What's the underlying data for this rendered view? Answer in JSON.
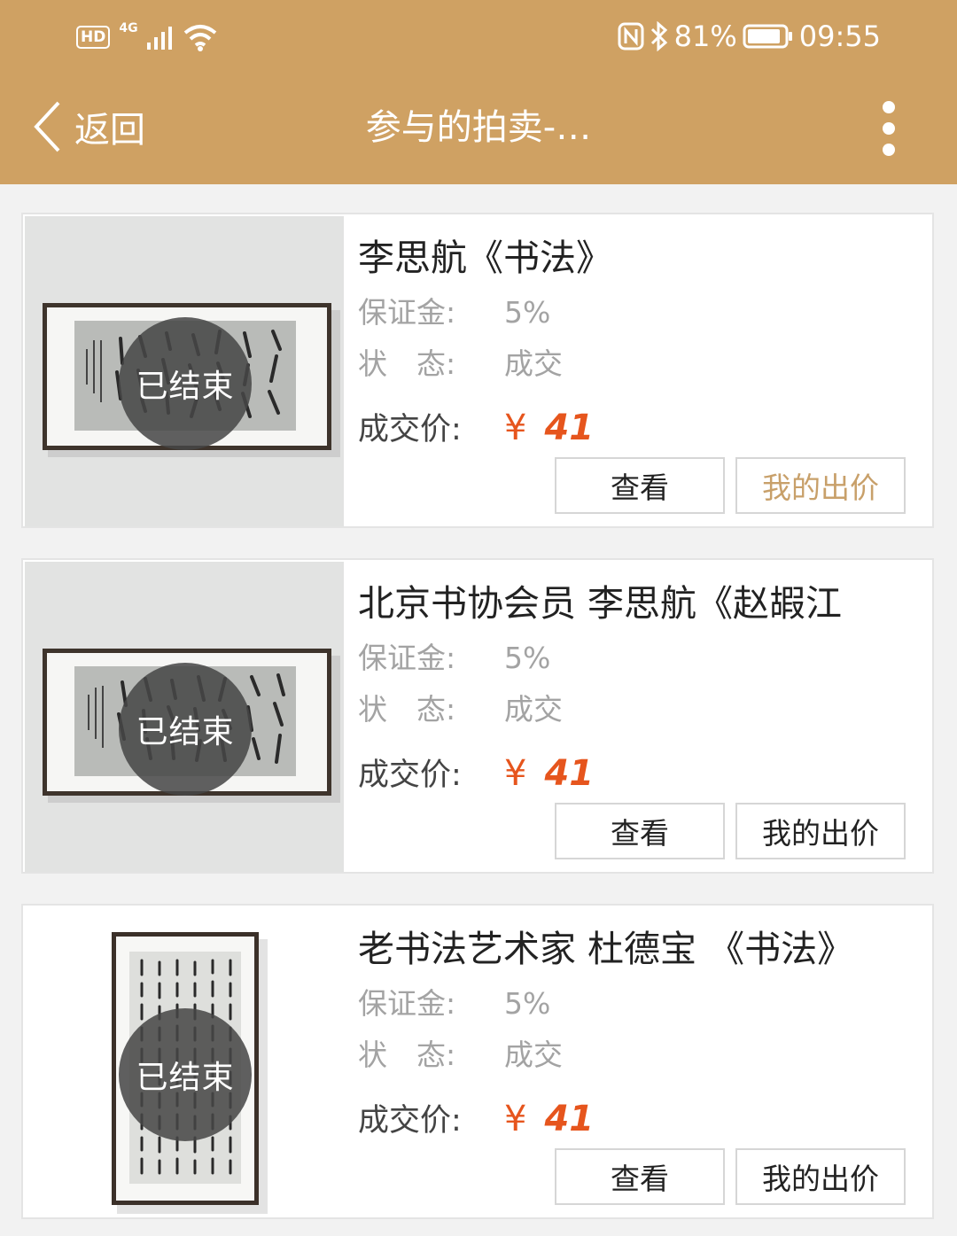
{
  "status_bar": {
    "hd": "HD",
    "network": "4G",
    "battery": "81%",
    "time": "09:55"
  },
  "nav": {
    "back_label": "返回",
    "title": "参与的拍卖-…",
    "back_icon": "chevron-left-icon",
    "more_icon": "more-vertical-icon"
  },
  "colors": {
    "header": "#cfa163",
    "price": "#e6551d",
    "bid_highlight": "#c8a06a"
  },
  "labels": {
    "deposit": "保证金:",
    "status": "状　态:",
    "deal_price": "成交价:",
    "currency": "¥",
    "view_button": "查看",
    "bid_button": "我的出价",
    "ended_badge": "已结束"
  },
  "items": [
    {
      "title": "李思航《书法》",
      "deposit": "5%",
      "status": "成交",
      "price": "41"
    },
    {
      "title": "北京书协会员 李思航《赵嘏江",
      "deposit": "5%",
      "status": "成交",
      "price": "41"
    },
    {
      "title": "老书法艺术家  杜德宝 《书法》",
      "deposit": "5%",
      "status": "成交",
      "price": "41"
    }
  ]
}
